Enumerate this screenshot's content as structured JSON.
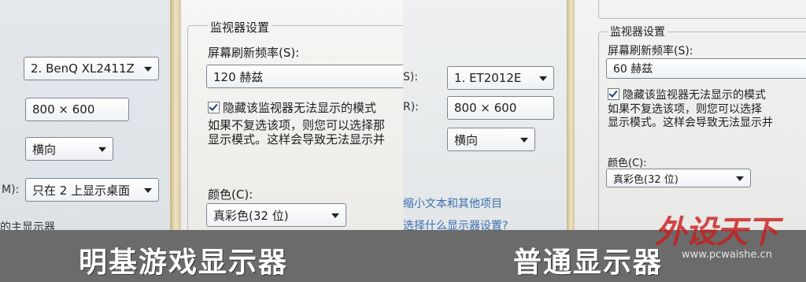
{
  "left_screen": {
    "monitor_select": "2. BenQ XL2411Z",
    "resolution_select": "800 × 600",
    "orientation_select": "横向",
    "multi_display_edge": "M):",
    "multi_display_select": "只在 2 上显示桌面",
    "bottom_text": "的主显示器",
    "monitor_settings": {
      "group_title": "监视器设置",
      "refresh_label": "屏幕刷新频率(S):",
      "refresh_select": "120 赫兹",
      "hide_modes_label": "隐藏该监视器无法显示的模式",
      "hide_modes_note_line1": "如果不复选该项，则您可以选择那",
      "hide_modes_note_line2": "显示模式。这样会导致无法显示并",
      "color_label": "颜色(C):",
      "color_select": "真彩色(32 位)"
    }
  },
  "right_screen": {
    "edge_s": "S):",
    "monitor_select": "1. ET2012E",
    "edge_r": "R):",
    "resolution_select": "800 × 600",
    "orientation_select": "横向",
    "link1": "缩小文本和其他项目",
    "link2": "选择什么显示器设置?",
    "monitor_settings": {
      "group_title": "监视器设置",
      "refresh_label": "屏幕刷新频率(S):",
      "refresh_select": "60 赫兹",
      "hide_modes_label": "隐藏该监视器无法显示的模式",
      "hide_modes_note_line1": "如果不复选该项，则您可以选择",
      "hide_modes_note_line2": "显示模式。这样会导致无法显示并",
      "color_label": "颜色(C):",
      "color_select": "真彩色(32 位)"
    }
  },
  "captions": {
    "left": "明基游戏显示器",
    "right": "普通显示器"
  },
  "watermark": {
    "logo": "外设天下",
    "url": "www.pcwaishe.cn"
  },
  "colors": {
    "caption_bar": "#6b6b6b",
    "watermark_red": "#c91c1c",
    "link_blue": "#3b6fb0"
  }
}
